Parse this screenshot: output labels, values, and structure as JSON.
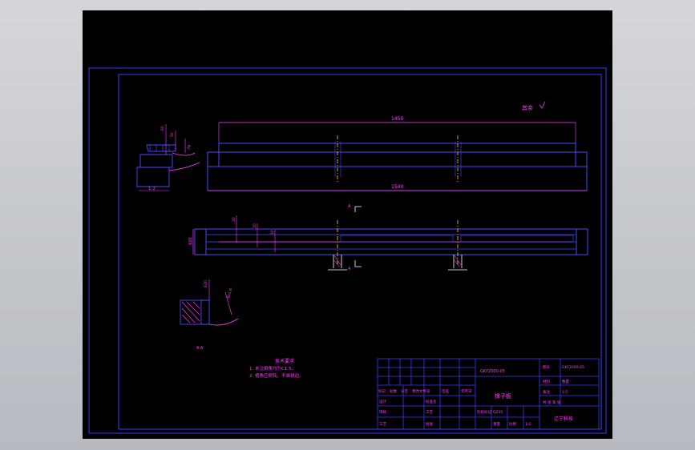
{
  "drawing": {
    "roughness_note": "其余",
    "length_top": "1450",
    "length_bottom": "1540",
    "dim_left_a": "60",
    "dim_left_b": "50",
    "dim_left_c": "28",
    "dim_small_1": "20",
    "dim_small_2": "20",
    "dim_small_3": "10",
    "height_label": "100",
    "taper_label": "1:2",
    "section_mark": "A",
    "section_view_label": "A-A",
    "detail_dim_a": "R20",
    "detail_dim_b": "Ra1.6",
    "tech_req_title": "技术要求",
    "tech_req_1": "1. 未注倒角均为C1.5。",
    "tech_req_2": "2. 棱角应倒钝，不准锐边。"
  },
  "title_block": {
    "drawing_no": "GKY2000-05",
    "part_name": "撑子板",
    "material": "Q235",
    "scale": "1:5",
    "company": "辽宁科技",
    "header_left_labels": [
      "标记",
      "处数",
      "分区",
      "更改文件号",
      "签名",
      "年月日"
    ],
    "row_design": "设计",
    "row_std": "标准化",
    "row_check": "审核",
    "row_craft": "工艺",
    "row_approve": "批准",
    "stage_label": "阶段标记",
    "weight_label": "重量",
    "scale_label": "比例",
    "sheet_label": "共 张 第 张",
    "right_top_1": "图号",
    "right_top_2": "GKY2000-05",
    "right_mid_1": "材料",
    "right_mid_2": "数量",
    "right_mid_3": "备注",
    "right_mid_4": "1:5"
  },
  "colors": {
    "frame": "#3a3aff",
    "magenta": "#ff3cff",
    "part": "#4a4aff",
    "hatch": "#ff3cff",
    "center": "#ffaa33",
    "white": "#ffffff"
  }
}
